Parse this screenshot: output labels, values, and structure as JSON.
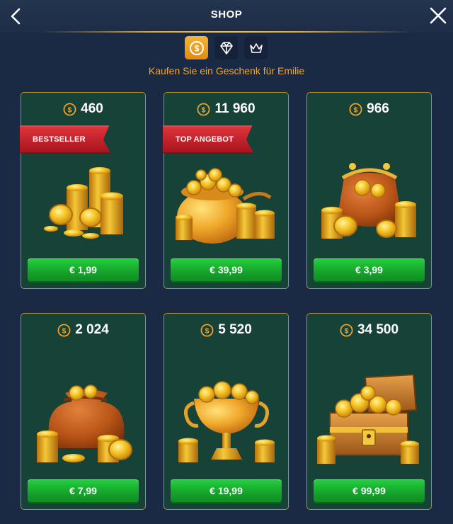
{
  "header": {
    "title": "SHOP"
  },
  "tabs": [
    {
      "name": "coins",
      "icon": "coin-icon",
      "active": true
    },
    {
      "name": "diamonds",
      "icon": "diamond-icon",
      "active": false
    },
    {
      "name": "vip",
      "icon": "crown-icon",
      "active": false
    }
  ],
  "subtitle": "Kaufen Sie ein Geschenk für Emilie",
  "packages": [
    {
      "amount": "460",
      "badge": "BESTSELLER",
      "price": "€ 1,99",
      "art": "coin-stacks"
    },
    {
      "amount": "11 960",
      "badge": "TOP ANGEBOT",
      "price": "€ 39,99",
      "art": "pot-of-gold"
    },
    {
      "amount": "966",
      "badge": "",
      "price": "€ 3,99",
      "art": "coin-purse"
    },
    {
      "amount": "2 024",
      "badge": "",
      "price": "€ 7,99",
      "art": "coin-sack"
    },
    {
      "amount": "5 520",
      "badge": "",
      "price": "€ 19,99",
      "art": "gold-trophy"
    },
    {
      "amount": "34 500",
      "badge": "",
      "price": "€ 99,99",
      "art": "treasure-chest"
    }
  ],
  "colors": {
    "background": "#1a2a45",
    "card": "#174238",
    "card_border": "#b58e2a",
    "accent_gold": "#f0a531",
    "price_green": "#1db533",
    "ribbon_red": "#c8202a"
  }
}
